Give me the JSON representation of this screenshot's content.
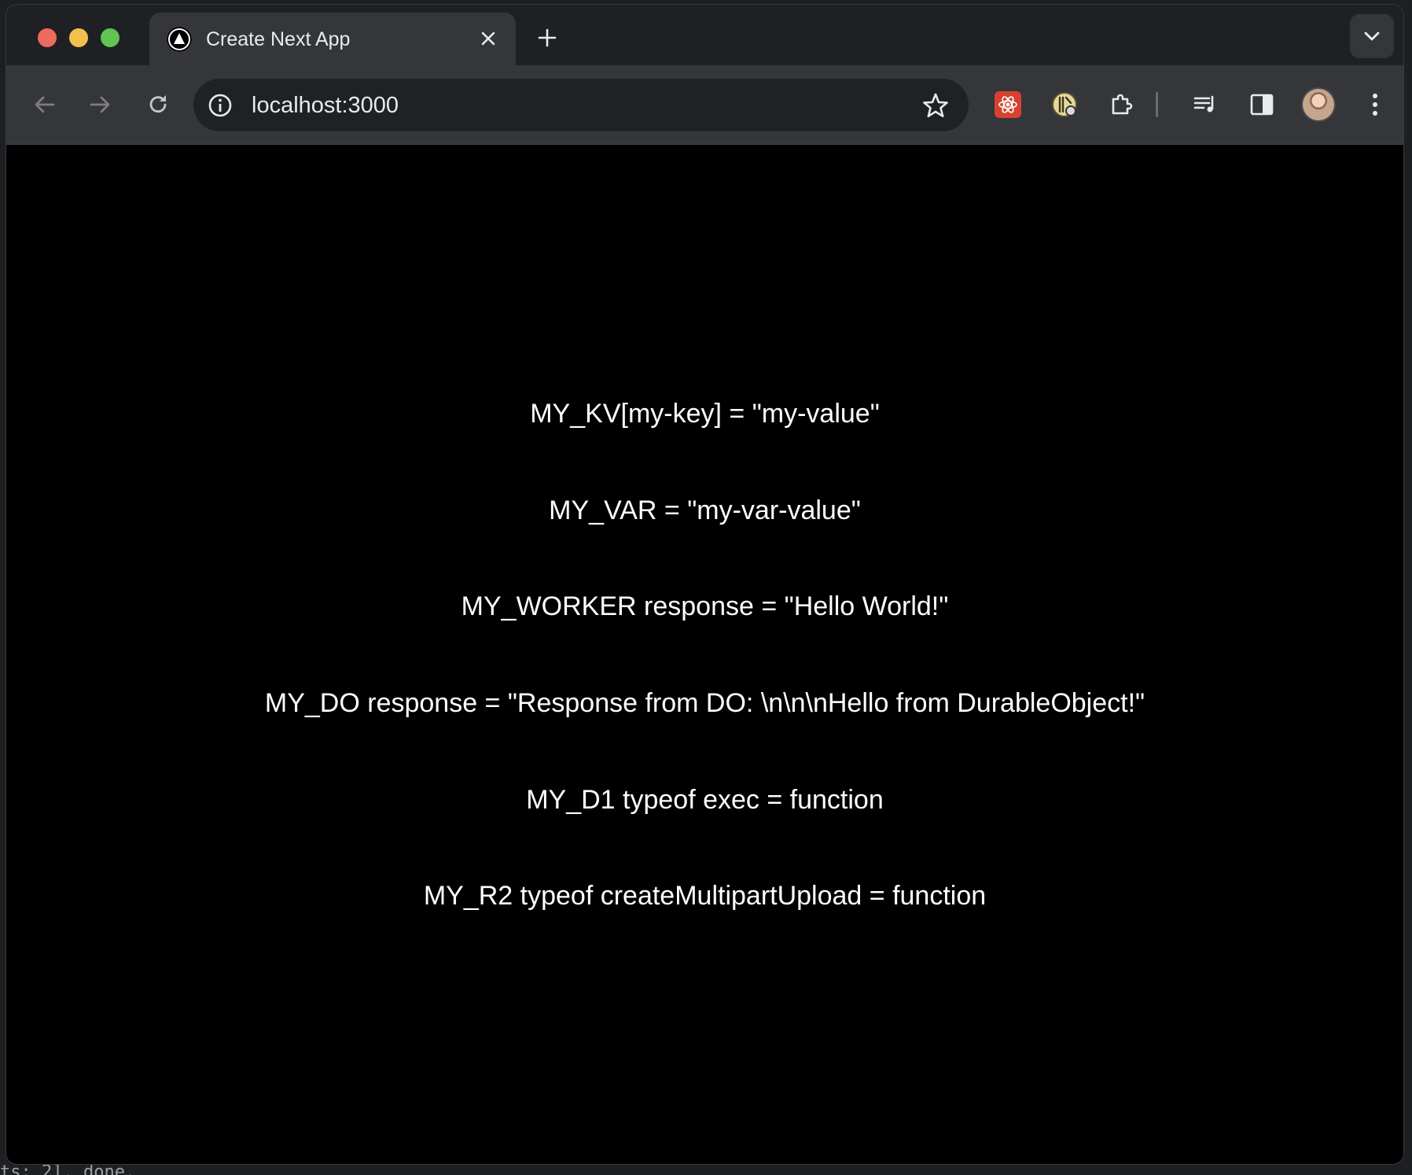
{
  "browser": {
    "tab": {
      "title": "Create Next App"
    },
    "omnibox": {
      "url": "localhost:3000"
    },
    "icons": {
      "favicon": "nextjs-triangle-icon",
      "close": "close-icon",
      "new_tab": "plus-icon",
      "tab_search": "chevron-down-icon",
      "back": "arrow-left-icon",
      "forward": "arrow-right-icon",
      "reload": "reload-icon",
      "site_info": "info-icon",
      "bookmark": "star-icon",
      "react_devtools": "react-devtools-icon",
      "extension_2": "extension-badge-icon",
      "extensions": "puzzle-icon",
      "media": "media-controls-icon",
      "side_panel": "side-panel-icon",
      "profile": "avatar",
      "menu": "kebab-menu-icon"
    },
    "colors": {
      "tab_strip": "#1f2023",
      "toolbar": "#35363a",
      "omnibox": "#202124",
      "page_background": "#000000",
      "page_text": "#ffffff",
      "react_ext": "#d5432f"
    }
  },
  "page": {
    "lines": [
      "MY_KV[my-key] = \"my-value\"",
      "MY_VAR = \"my-var-value\"",
      "MY_WORKER response = \"Hello World!\"",
      "MY_DO response = \"Response from DO: \\n\\n\\nHello from DurableObject!\"",
      "MY_D1 typeof exec = function",
      "MY_R2 typeof createMultipartUpload = function"
    ]
  },
  "background_terminal": {
    "footer_text": "ts: 2]. done."
  }
}
